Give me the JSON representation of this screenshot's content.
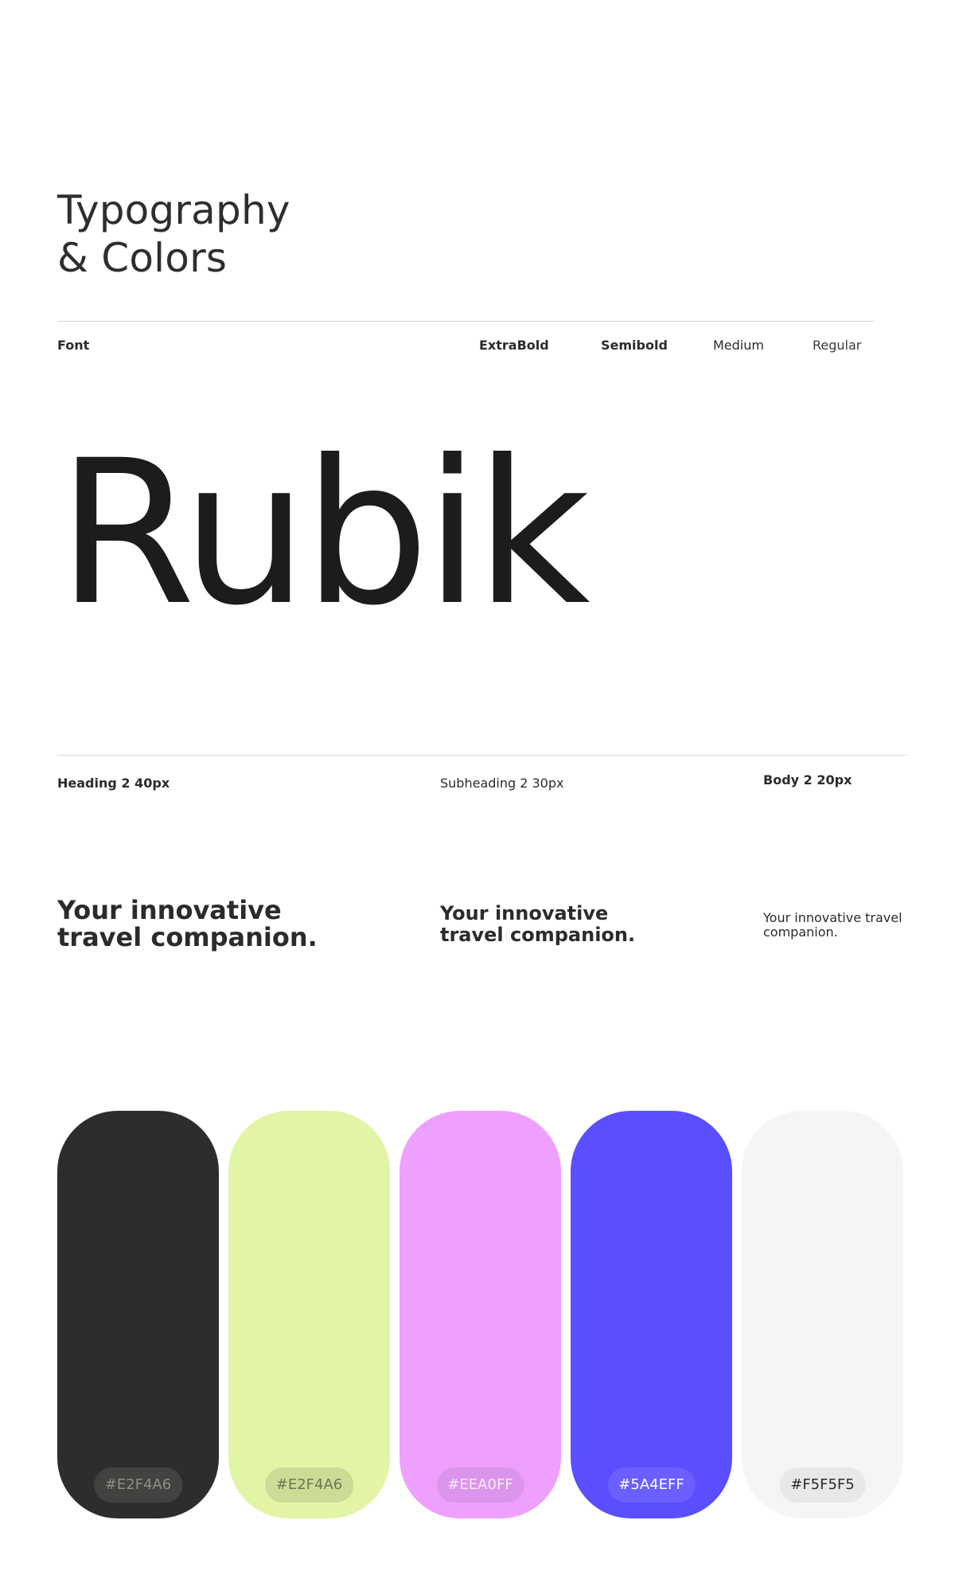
{
  "title": {
    "line1": "Typography",
    "line2": "& Colors"
  },
  "font": {
    "label": "Font",
    "name": "Rubik",
    "weights": [
      "ExtraBold",
      "Semibold",
      "Medium",
      "Regular"
    ]
  },
  "type_scale": [
    {
      "label": "Heading 2  40px",
      "sample_line1": "Your innovative",
      "sample_line2": "travel companion."
    },
    {
      "label": "Subheading 2 30px",
      "sample_line1": "Your innovative",
      "sample_line2": "travel companion."
    },
    {
      "label": "Body 2  20px",
      "sample_line1": "Your innovative travel",
      "sample_line2": "companion."
    }
  ],
  "palette": [
    {
      "color": "#2E2D2B",
      "label": "#E2F4A6",
      "pill_bg": "#434240",
      "pill_text": "#8e8d8a"
    },
    {
      "color": "#E2F4A6",
      "label": "#E2F4A6",
      "pill_bg": "#cbdc96",
      "pill_text": "#6e7558"
    },
    {
      "color": "#EEA0FF",
      "label": "#EEA0FF",
      "pill_bg": "#dc95ec",
      "pill_text": "#f8ecfc"
    },
    {
      "color": "#5A4EFF",
      "label": "#5A4EFF",
      "pill_bg": "#6a60ff",
      "pill_text": "#ffffff"
    },
    {
      "color": "#F5F5F5",
      "label": "#F5F5F5",
      "pill_bg": "#e8e8e8",
      "pill_text": "#2b2b2b"
    }
  ]
}
